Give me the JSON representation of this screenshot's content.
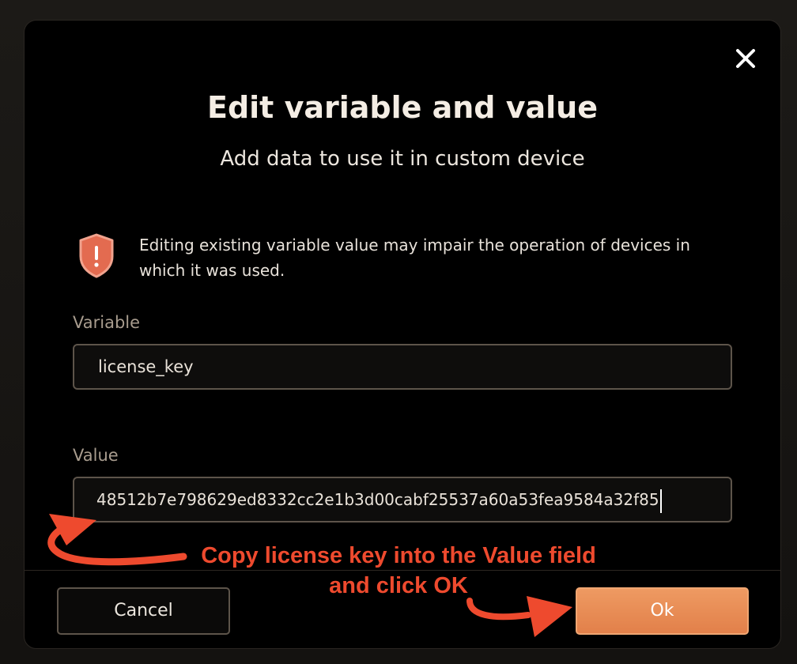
{
  "dialog": {
    "title": "Edit variable and value",
    "subtitle": "Add data to use it in custom device",
    "warning": {
      "icon": "shield-alert-icon",
      "text": "Editing existing variable value may impair the operation of devices in which it was used."
    },
    "variable": {
      "label": "Variable",
      "value": "license_key"
    },
    "value_field": {
      "label": "Value",
      "value": "48512b7e798629ed8332cc2e1b3d00cabf25537a60a53fea9584a32f85"
    },
    "cancel_label": "Cancel",
    "ok_label": "Ok",
    "close_icon": "close-icon"
  },
  "annotation": {
    "line1": "Copy license key into the Value field",
    "line2": "and click OK",
    "color": "#ee4a2e"
  },
  "colors": {
    "accent": "#e88a52",
    "warning_icon": "#e36b50",
    "background": "#000000"
  }
}
